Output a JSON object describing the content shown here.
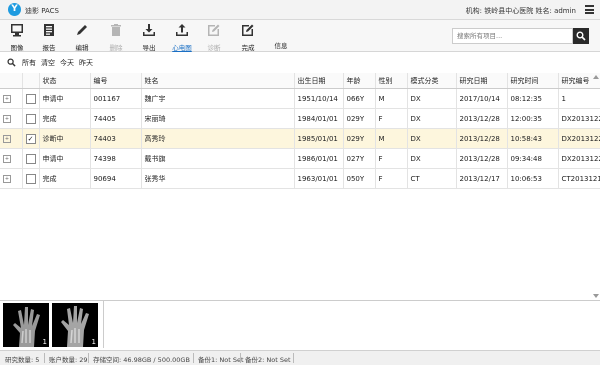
{
  "app": {
    "title": "迪影 PACS",
    "logo_text": "Y",
    "org_info": "机构: 铁岭县中心医院 姓名: admin"
  },
  "toolbar": [
    {
      "label": "图像",
      "icon": "monitor-icon",
      "state": "normal"
    },
    {
      "label": "报告",
      "icon": "report-icon",
      "state": "normal"
    },
    {
      "label": "编辑",
      "icon": "pencil-icon",
      "state": "normal"
    },
    {
      "label": "删除",
      "icon": "trash-icon",
      "state": "disabled"
    },
    {
      "label": "导出",
      "icon": "download-icon",
      "state": "normal"
    },
    {
      "label": "心电图",
      "icon": "upload-icon",
      "state": "active"
    },
    {
      "label": "诊断",
      "icon": "edit-box-icon",
      "state": "disabled"
    },
    {
      "label": "完成",
      "icon": "edit-box-icon",
      "state": "normal"
    },
    {
      "label": "信息",
      "icon": "",
      "state": "normal"
    }
  ],
  "search": {
    "placeholder": "搜索所有项目...",
    "icon": "search-icon"
  },
  "filters": {
    "icon": "search-icon",
    "items": [
      "所有",
      "清空",
      "今天",
      "昨天"
    ]
  },
  "table": {
    "columns": [
      "",
      "",
      "状态",
      "编号",
      "姓名",
      "出生日期",
      "年龄",
      "性别",
      "模式分类",
      "研究日期",
      "研究时间",
      "研究编号"
    ],
    "rows": [
      {
        "status": "申请中",
        "id": "001167",
        "name": "魏广宇",
        "dob": "1951/10/14",
        "age": "066Y",
        "sex": "M",
        "modality": "DX",
        "study_date": "2017/10/14",
        "study_time": "08:12:35",
        "study_no": "1",
        "checked": false
      },
      {
        "status": "完成",
        "id": "74405",
        "name": "宋丽琦",
        "dob": "1984/01/01",
        "age": "029Y",
        "sex": "F",
        "modality": "DX",
        "study_date": "2013/12/28",
        "study_time": "12:00:35",
        "study_no": "DX2013122",
        "checked": false
      },
      {
        "status": "诊断中",
        "id": "74403",
        "name": "高秀玲",
        "dob": "1985/01/01",
        "age": "029Y",
        "sex": "M",
        "modality": "DX",
        "study_date": "2013/12/28",
        "study_time": "10:58:43",
        "study_no": "DX2013122",
        "checked": true
      },
      {
        "status": "申请中",
        "id": "74398",
        "name": "戴书旗",
        "dob": "1986/01/01",
        "age": "027Y",
        "sex": "F",
        "modality": "DX",
        "study_date": "2013/12/28",
        "study_time": "09:34:48",
        "study_no": "DX2013122",
        "checked": false
      },
      {
        "status": "完成",
        "id": "90694",
        "name": "张秀华",
        "dob": "1963/01/01",
        "age": "050Y",
        "sex": "F",
        "modality": "CT",
        "study_date": "2013/12/17",
        "study_time": "10:06:53",
        "study_no": "CT2013121",
        "checked": false
      }
    ],
    "selected_row": 2,
    "selected_color": "#fdf6dd"
  },
  "thumbnails": [
    {
      "number": "1"
    },
    {
      "number": "1"
    }
  ],
  "status_bar": [
    "研究数量: 5",
    "账户数量: 29",
    "存储空间: 46.98GB / 500.00GB",
    "备份1: Not Set",
    "备份2: Not Set"
  ],
  "colors": {
    "accent": "#1e9be0",
    "active_link": "#1a6fc4"
  }
}
